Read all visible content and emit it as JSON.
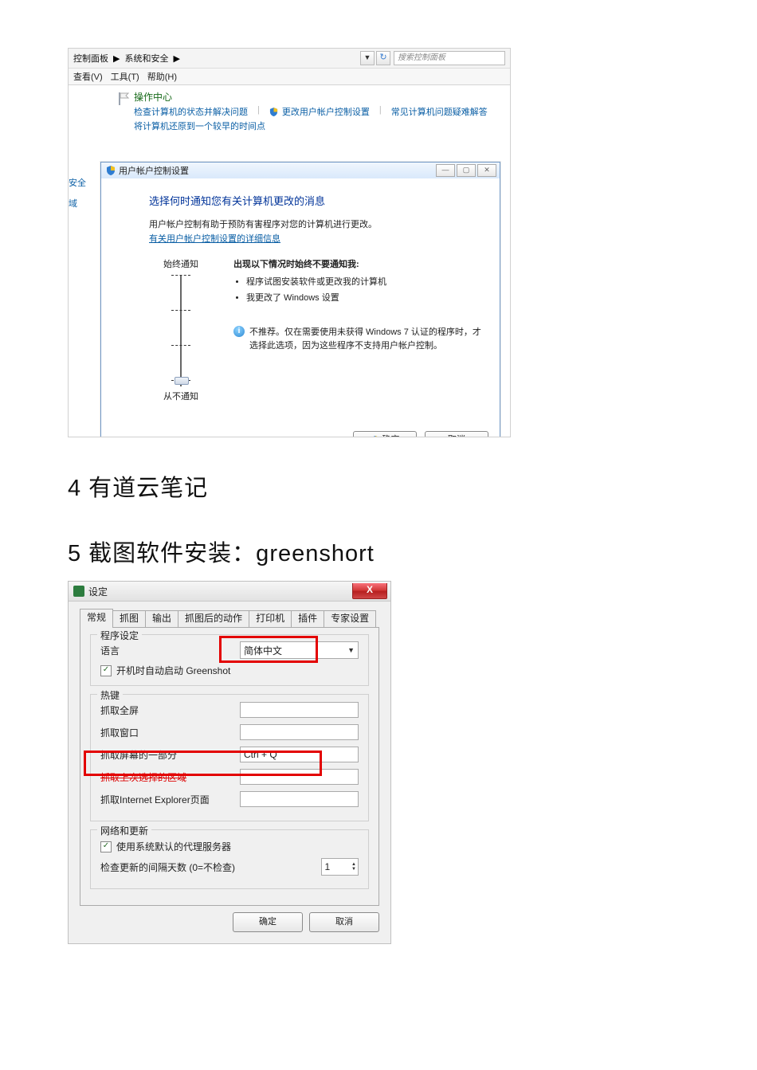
{
  "section4": "4  有道云笔记",
  "section5": "5  截图软件安装：greenshort",
  "cp": {
    "crumb1": "控制面板",
    "crumb2": "系统和安全",
    "search_placeholder": "搜索控制面板",
    "menu": {
      "view": "查看(V)",
      "tools": "工具(T)",
      "help": "帮助(H)"
    },
    "action_center": {
      "title": "操作中心",
      "link1": "检查计算机的状态并解决问题",
      "link2": "更改用户帐户控制设置",
      "link3": "常见计算机问题疑难解答",
      "link4": "将计算机还原到一个较早的时间点"
    },
    "sidebar": {
      "item1": "安全",
      "item2": "域"
    }
  },
  "uac": {
    "title": "用户帐户控制设置",
    "heading": "选择何时通知您有关计算机更改的消息",
    "desc": "用户帐户控制有助于预防有害程序对您的计算机进行更改。",
    "link": "有关用户帐户控制设置的详细信息",
    "slider_top": "始终通知",
    "slider_bottom": "从不通知",
    "panel_heading": "出现以下情况时始终不要通知我:",
    "bullet1": "程序试图安装软件或更改我的计算机",
    "bullet2": "我更改了 Windows 设置",
    "note": "不推荐。仅在需要使用未获得 Windows 7 认证的程序时，才选择此选项，因为这些程序不支持用户帐户控制。",
    "ok": "确定",
    "cancel": "取消"
  },
  "gs": {
    "title": "设定",
    "close": "X",
    "tabs": {
      "general": "常规",
      "capture": "抓图",
      "output": "输出",
      "postcap": "抓图后的动作",
      "printer": "打印机",
      "plugins": "插件",
      "expert": "专家设置"
    },
    "group_program": "程序设定",
    "lang_label": "语言",
    "lang_value": "简体中文",
    "autostart_label": "开机时自动启动 Greenshot",
    "group_hotkeys": "热键",
    "hk_fullscreen": "抓取全屏",
    "hk_window": "抓取窗口",
    "hk_region": "抓取屏幕的一部分",
    "hk_region_value": "Ctrl + Q",
    "hk_last": "抓取上次选择的区域",
    "hk_ie": "抓取Internet Explorer页面",
    "group_network": "网络和更新",
    "proxy_label": "使用系统默认的代理服务器",
    "update_label": "检查更新的间隔天数 (0=不检查)",
    "update_value": "1",
    "ok": "确定",
    "cancel": "取消"
  }
}
